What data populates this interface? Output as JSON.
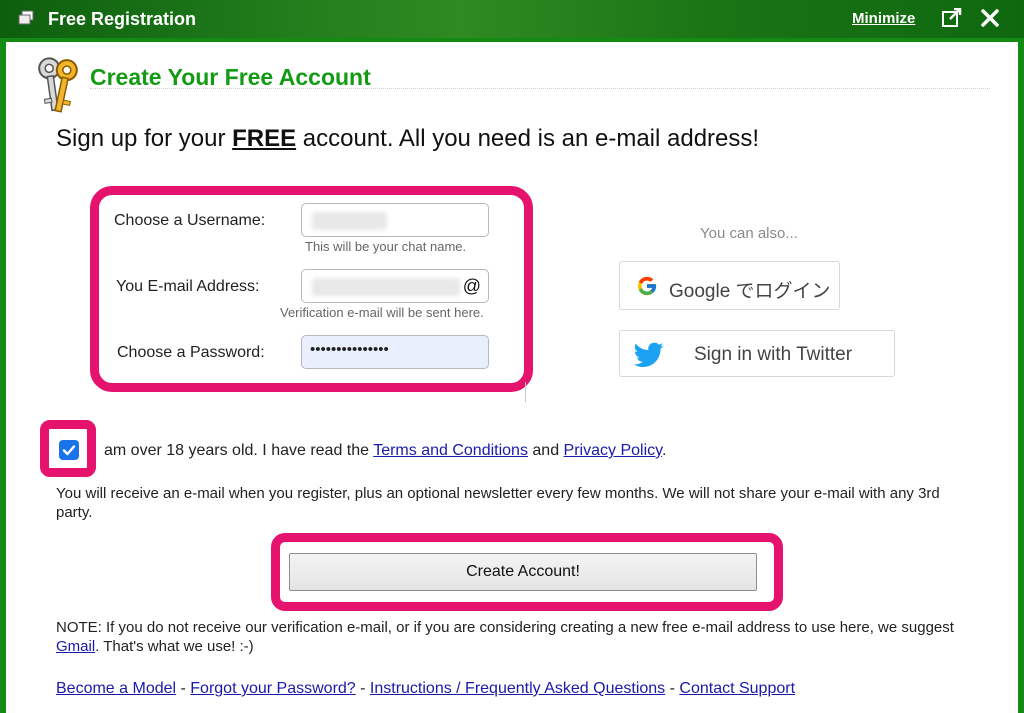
{
  "window": {
    "title": "Free Registration",
    "minimize_label": "Minimize"
  },
  "page": {
    "heading": "Create Your Free Account",
    "lead_before": "Sign up for your ",
    "lead_free": "FREE",
    "lead_after": " account.  All you need is an e-mail address!"
  },
  "form": {
    "username_label": "Choose a Username:",
    "username_hint": "This will be your chat name.",
    "email_label": "You E-mail Address:",
    "email_suffix": "@",
    "email_hint": "Verification e-mail will be sent here.",
    "password_label": "Choose a Password:",
    "password_value": "•••••••••••••••"
  },
  "social": {
    "intro": "You can also...",
    "google_label": "Google でログイン",
    "twitter_label": "Sign in with Twitter"
  },
  "agreement": {
    "checked": true,
    "text_before": "am over 18 years old. I have read the ",
    "terms_link": "Terms and Conditions",
    "text_middle": " and ",
    "privacy_link": "Privacy Policy",
    "text_after": "."
  },
  "info_text": "You will receive an e-mail when you register, plus an optional newsletter every few months. We will not share your e-mail with any 3rd party.",
  "create_button": "Create Account!",
  "note": {
    "text_before": "NOTE: If you do not receive our verification e-mail, or if you are considering creating a new free e-mail address to use here, we suggest ",
    "gmail_link": "Gmail",
    "text_after": ".  That's what we use! :-)"
  },
  "footer": {
    "links": [
      "Become a Model",
      "Forgot your Password?",
      "Instructions / Frequently Asked Questions",
      "Contact Support"
    ],
    "separator": " - "
  },
  "colors": {
    "brand_green": "#149b14",
    "highlight": "#e5136d",
    "link": "#1a1aaa",
    "checkbox": "#1a73e8"
  }
}
